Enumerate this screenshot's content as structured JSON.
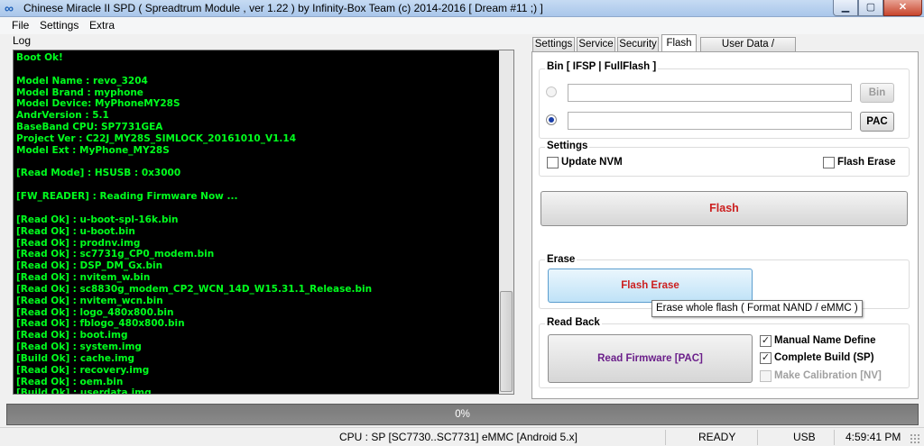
{
  "window": {
    "title": "Chinese Miracle II SPD ( Spreadtrum Module , ver 1.22 ) by Infinity-Box Team (c) 2014-2016 [ Dream #11 ;) ]",
    "min_glyph": "▁",
    "max_glyph": "▢",
    "close_glyph": "✕",
    "app_icon_glyph": "∞"
  },
  "menu": {
    "file": "File",
    "settings": "Settings",
    "extra": "Extra"
  },
  "log": {
    "label": "Log",
    "lines": [
      "Boot Ok!",
      "",
      "Model Name  : revo_3204",
      "Model Brand : myphone",
      "Model Device: MyPhoneMY28S",
      "AndrVersion : 5.1",
      "BaseBand CPU: SP7731GEA",
      "Project Ver : C22J_MY28S_SIMLOCK_20161010_V1.14",
      "Model Ext   : MyPhone_MY28S",
      "",
      "[Read Mode] : HSUSB : 0x3000",
      "",
      "[FW_READER] : Reading Firmware Now ...",
      "",
      "[Read Ok] : u-boot-spl-16k.bin",
      "[Read Ok] : u-boot.bin",
      "[Read Ok] : prodnv.img",
      "[Read Ok] : sc7731g_CP0_modem.bin",
      "[Read Ok] : DSP_DM_Gx.bin",
      "[Read Ok] : nvitem_w.bin",
      "[Read Ok] : sc8830g_modem_CP2_WCN_14D_W15.31.1_Release.bin",
      "[Read Ok] : nvitem_wcn.bin",
      "[Read Ok] : logo_480x800.bin",
      "[Read Ok] : fblogo_480x800.bin",
      "[Read Ok] : boot.img",
      "[Read Ok] : system.img",
      "[Build Ok] : cache.img",
      "[Read Ok] : recovery.img",
      "[Read Ok] : oem.bin",
      "[Build Ok] : userdata.img"
    ]
  },
  "tabs": [
    {
      "label": "Settings",
      "active": false
    },
    {
      "label": "Service",
      "active": false
    },
    {
      "label": "Security",
      "active": false
    },
    {
      "label": "Flash",
      "active": true
    },
    {
      "label": "User Data / Forensic",
      "active": false
    }
  ],
  "flash_tab": {
    "bin_group": {
      "title": "Bin  [ IFSP | FullFlash ]",
      "bin_path_value": "",
      "pac_path_value": "",
      "bin_button": "Bin",
      "pac_button": "PAC",
      "bin_selected": false,
      "pac_selected": true
    },
    "settings_group": {
      "title": "Settings",
      "update_nvm": {
        "label": "Update NVM",
        "checked": false
      },
      "flash_erase_opt": {
        "label": "Flash Erase",
        "checked": false
      }
    },
    "flash_button": "Flash",
    "erase_group": {
      "title": "Erase",
      "flash_erase_button": "Flash Erase",
      "tooltip": "Erase whole flash ( Format NAND / eMMC )"
    },
    "readback_group": {
      "title": "Read Back",
      "read_firmware_button": "Read Firmware [PAC]",
      "manual_name": {
        "label": "Manual Name Define",
        "checked": true
      },
      "complete_build": {
        "label": "Complete Build (SP)",
        "checked": true
      },
      "make_calibration": {
        "label": "Make Calibration [NV]",
        "checked": false,
        "disabled": true
      }
    }
  },
  "progress": {
    "label": "0%",
    "value": 0
  },
  "status": {
    "cpu": "CPU : SP [SC7730..SC7731] eMMC [Android 5.x]",
    "state": "READY",
    "port": "USB",
    "time": "4:59:41 PM"
  },
  "colors": {
    "log_text": "#00ff1e",
    "flash_label": "#cc1f1f",
    "read_firmware_label": "#6b1f8a"
  }
}
